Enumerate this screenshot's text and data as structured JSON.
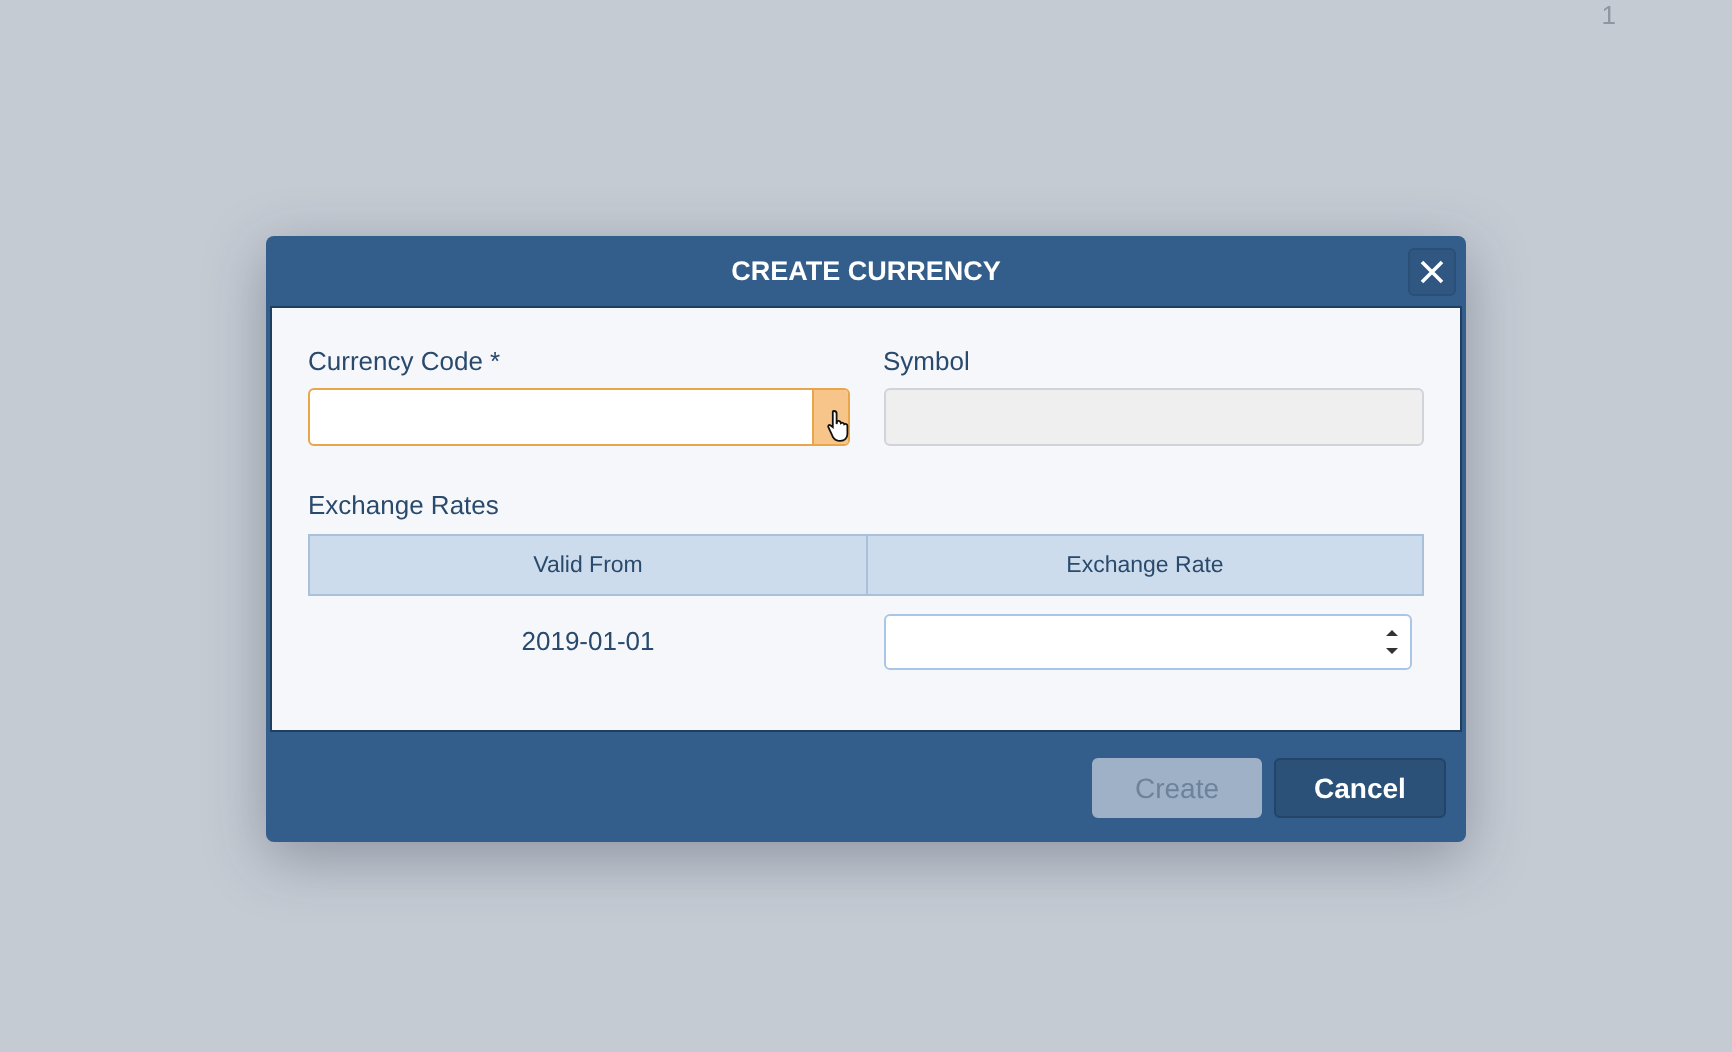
{
  "page_number": "1",
  "dialog": {
    "title": "CREATE CURRENCY",
    "fields": [
      {
        "label": "Currency Code *",
        "kind": "dropdown",
        "focused": true,
        "disabled": false
      },
      {
        "label": "Symbol",
        "kind": "text",
        "focused": false,
        "disabled": true
      }
    ],
    "exchange_rates": {
      "label": "Exchange Rates",
      "columns": [
        "Valid From",
        "Exchange Rate"
      ],
      "rows": [
        {
          "valid_from": "2019-01-01"
        }
      ]
    },
    "buttons": [
      {
        "label": "Create",
        "disabled": true
      },
      {
        "label": "Cancel",
        "disabled": false
      }
    ]
  }
}
